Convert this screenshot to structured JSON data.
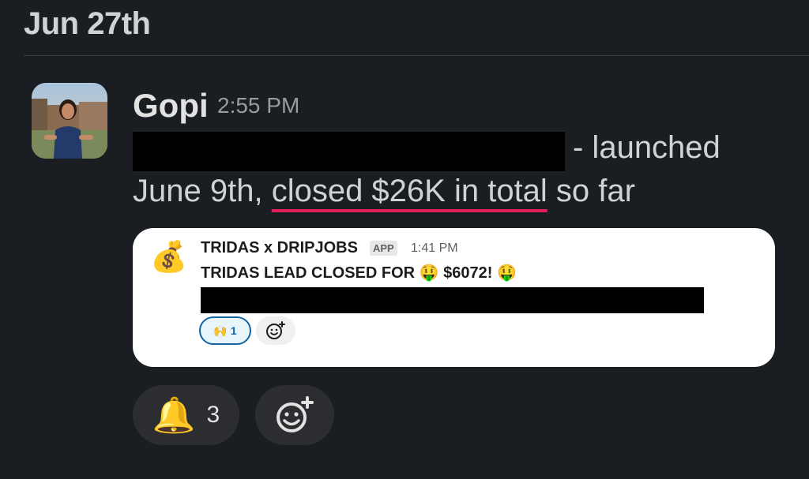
{
  "header": {
    "date": "Jun 27th"
  },
  "message": {
    "author": "Gopi",
    "time": "2:55 PM",
    "text_line1_suffix": "- launched",
    "text_line2_prefix": "June 9th, ",
    "text_line2_highlight": "closed $26K in total",
    "text_line2_suffix": " so far",
    "highlight_color": "#e01e5a"
  },
  "attachment": {
    "icon": "💰",
    "title": "TRIDAS x DRIPJOBS",
    "badge": "APP",
    "time": "1:41 PM",
    "line_prefix": "TRIDAS LEAD CLOSED FOR ",
    "emoji_left": "🤑",
    "amount": " $6072! ",
    "emoji_right": "🤑",
    "reaction": {
      "emoji": "🙌",
      "count": "1"
    }
  },
  "reactions": [
    {
      "emoji": "🔔",
      "count": "3"
    }
  ],
  "icons": {
    "add_reaction": "add-reaction-icon"
  }
}
